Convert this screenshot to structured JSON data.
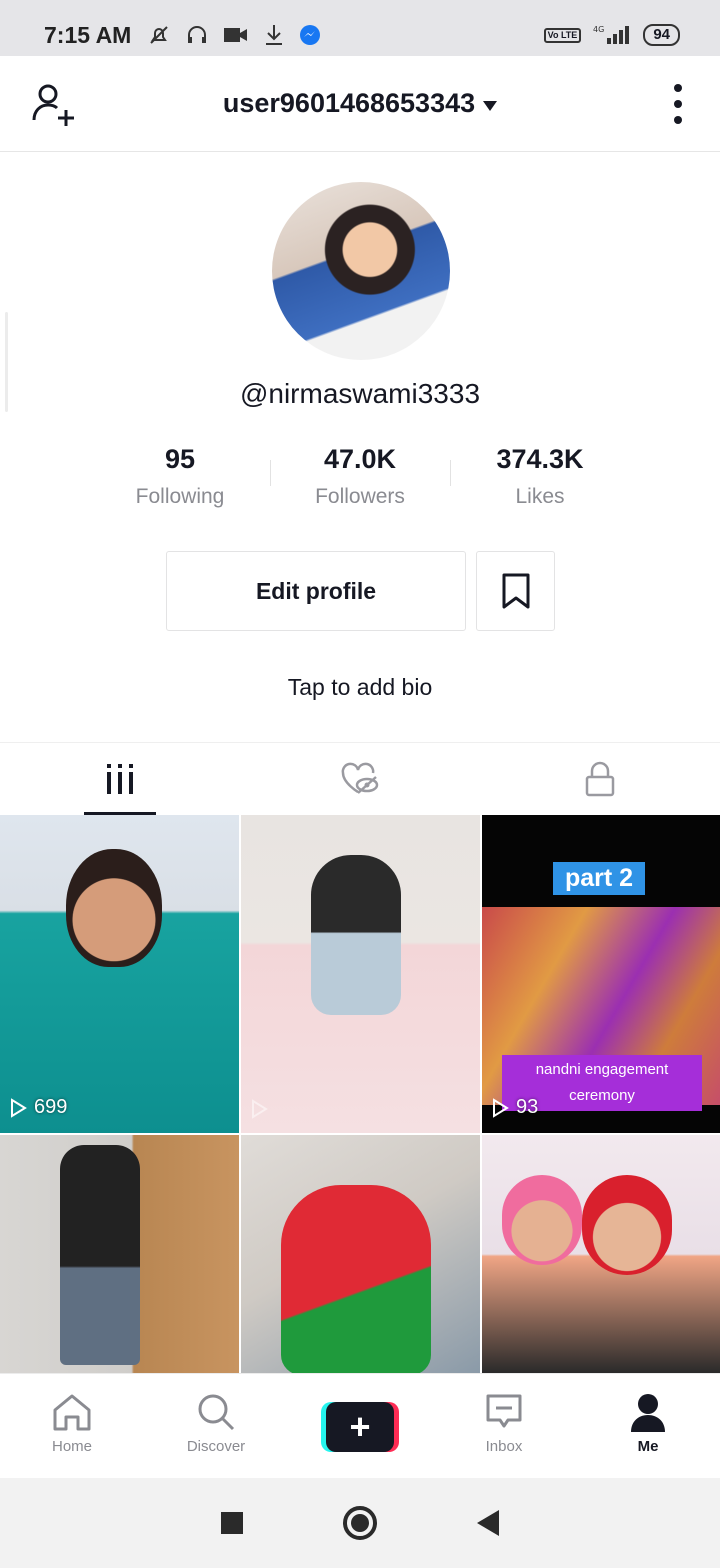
{
  "status_bar": {
    "time": "7:15 AM",
    "network": "4G",
    "volte": "Vo LTE",
    "battery": "94",
    "icons": [
      "mute-icon",
      "headphones-icon",
      "video-icon",
      "download-icon",
      "messenger-icon",
      "signal-icon"
    ]
  },
  "header": {
    "username": "user9601468653343",
    "add_friends_icon": "add-user-icon",
    "more_icon": "more-vertical-icon"
  },
  "profile": {
    "handle": "@nirmaswami3333",
    "stats": [
      {
        "value": "95",
        "label": "Following"
      },
      {
        "value": "47.0K",
        "label": "Followers"
      },
      {
        "value": "374.3K",
        "label": "Likes"
      }
    ],
    "edit_profile_label": "Edit profile",
    "bio_prompt": "Tap to add bio"
  },
  "tabs": [
    {
      "icon": "videos-grid-icon",
      "active": true
    },
    {
      "icon": "liked-hidden-icon",
      "active": false
    },
    {
      "icon": "lock-icon",
      "active": false
    }
  ],
  "videos": [
    {
      "views": "699"
    },
    {
      "views": ""
    },
    {
      "views": "93",
      "overlay_title": "part 2",
      "overlay_caption": "nandni engagement ceremony"
    },
    {
      "views": ""
    },
    {
      "views": ""
    },
    {
      "views": ""
    }
  ],
  "bottom_nav": [
    {
      "label": "Home",
      "icon": "home-icon"
    },
    {
      "label": "Discover",
      "icon": "search-icon"
    },
    {
      "label": "",
      "icon": "plus-icon"
    },
    {
      "label": "Inbox",
      "icon": "inbox-icon"
    },
    {
      "label": "Me",
      "icon": "profile-icon",
      "active": true
    }
  ],
  "colors": {
    "text_primary": "#161823",
    "text_secondary": "#8a8b91",
    "accent_cyan": "#25f4ee",
    "accent_red": "#fe2c55",
    "status_bar_bg": "#e5e5e8"
  }
}
